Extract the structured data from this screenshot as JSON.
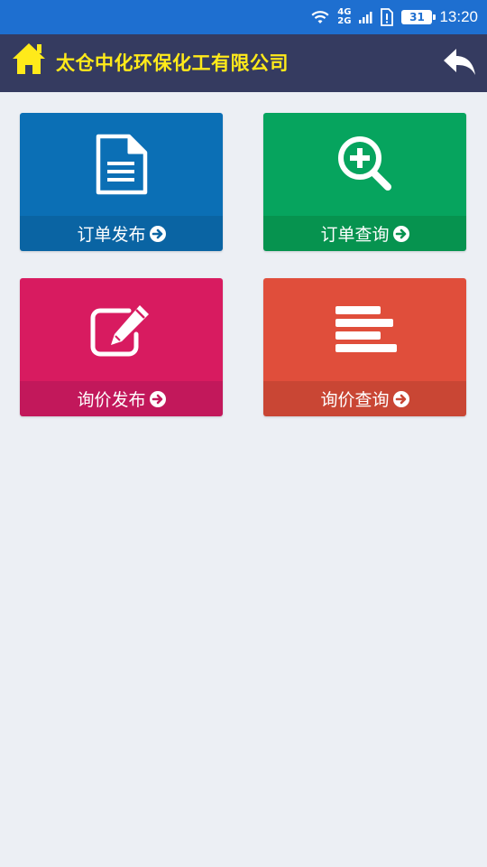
{
  "status_bar": {
    "time": "13:20",
    "battery_level": "31",
    "network_4g": "4G",
    "network_2g": "2G",
    "background": "#1E6FD0"
  },
  "header": {
    "title": "太仓中化环保化工有限公司",
    "title_color": "#FFEA1A",
    "background": "#353B60",
    "left_icon": "home-icon",
    "right_icon": "back-reply-icon"
  },
  "tiles": [
    {
      "label": "订单发布",
      "icon": "document-icon",
      "color_top": "#0B6FB5",
      "color_bottom": "#0A64A3"
    },
    {
      "label": "订单查询",
      "icon": "zoom-in-icon",
      "color_top": "#06A45E",
      "color_bottom": "#06934F"
    },
    {
      "label": "询价发布",
      "icon": "edit-icon",
      "color_top": "#D81B60",
      "color_bottom": "#C2185B"
    },
    {
      "label": "询价查询",
      "icon": "align-left-icon",
      "color_top": "#E04E3B",
      "color_bottom": "#C94634"
    }
  ]
}
